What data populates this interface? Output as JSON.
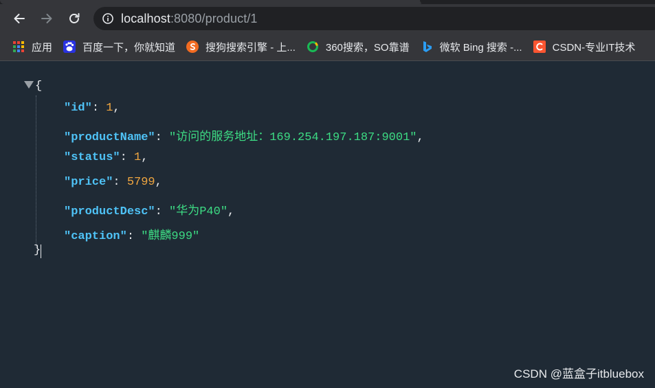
{
  "browser": {
    "url_host": "localhost",
    "url_rest": ":8080/product/1"
  },
  "bookmarks": [
    {
      "label": "应用",
      "icon": "apps-grid-icon"
    },
    {
      "label": "百度一下，你就知道",
      "icon": "baidu-icon"
    },
    {
      "label": "搜狗搜索引擎 - 上...",
      "icon": "sogou-icon"
    },
    {
      "label": "360搜索，SO靠谱",
      "icon": "360-search-icon"
    },
    {
      "label": "微软 Bing 搜索 -...",
      "icon": "bing-icon"
    },
    {
      "label": "CSDN-专业IT技术",
      "icon": "csdn-icon"
    }
  ],
  "json_view": {
    "open_brace": "{",
    "close_brace": "}",
    "entries": [
      {
        "key": "\"id\"",
        "value": "1",
        "type": "num",
        "comma": ","
      },
      {
        "key": "\"productName\"",
        "value": "\"访问的服务地址：169.254.197.187:9001\"",
        "type": "str",
        "comma": ","
      },
      {
        "key": "\"status\"",
        "value": "1",
        "type": "num",
        "comma": ","
      },
      {
        "key": "\"price\"",
        "value": "5799",
        "type": "num",
        "comma": ","
      },
      {
        "key": "\"productDesc\"",
        "value": "\"华为P40\"",
        "type": "str",
        "comma": ","
      },
      {
        "key": "\"caption\"",
        "value": "\"麒麟999\"",
        "type": "str",
        "comma": ""
      }
    ]
  },
  "watermark": "CSDN @蓝盒子itbluebox",
  "colors": {
    "page_bg": "#1f2a35",
    "key": "#4fc3f7",
    "number": "#f0a640",
    "string": "#3ddc84"
  }
}
